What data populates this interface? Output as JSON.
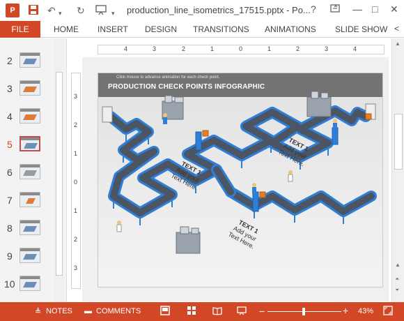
{
  "window": {
    "app_icon": "P",
    "title": "production_line_isometrics_17515.pptx - Po...",
    "help": "?",
    "minimize": "—",
    "maximize": "□",
    "close": "✕"
  },
  "qat": {
    "save": "save-icon",
    "undo": "↶",
    "redo": "↻",
    "present": "slideshow-icon",
    "more": "▾"
  },
  "ribbon": {
    "file": "FILE",
    "tabs": [
      "HOME",
      "INSERT",
      "DESIGN",
      "TRANSITIONS",
      "ANIMATIONS",
      "SLIDE SHOW"
    ],
    "more": "<"
  },
  "thumbnails": {
    "numbers": [
      "2",
      "3",
      "4",
      "5",
      "6",
      "7",
      "8",
      "9",
      "10"
    ],
    "active": "5"
  },
  "ruler": {
    "h_ticks": [
      "4",
      "3",
      "2",
      "1",
      "0",
      "1",
      "2",
      "3",
      "4"
    ],
    "v_ticks": [
      "3",
      "2",
      "1",
      "0",
      "1",
      "2",
      "3"
    ]
  },
  "slide": {
    "hint": "Click mouse to advance animation for each check point.",
    "title": "PRODUCTION CHECK POINTS INFOGRAPHIC",
    "text_blocks": [
      {
        "head": "TEXT 1",
        "line1": "Add your",
        "line2": "Text Here."
      },
      {
        "head": "TEXT 1",
        "line1": "Add your",
        "line2": "Text Here."
      },
      {
        "head": "TEXT 1",
        "line1": "Add your",
        "line2": "Text Here."
      }
    ]
  },
  "status": {
    "notes": "NOTES",
    "comments": "COMMENTS",
    "zoom_minus": "−",
    "zoom_plus": "+",
    "zoom": "43%"
  },
  "colors": {
    "accent": "#d24726",
    "conveyor_blue": "#2f7fd8"
  }
}
